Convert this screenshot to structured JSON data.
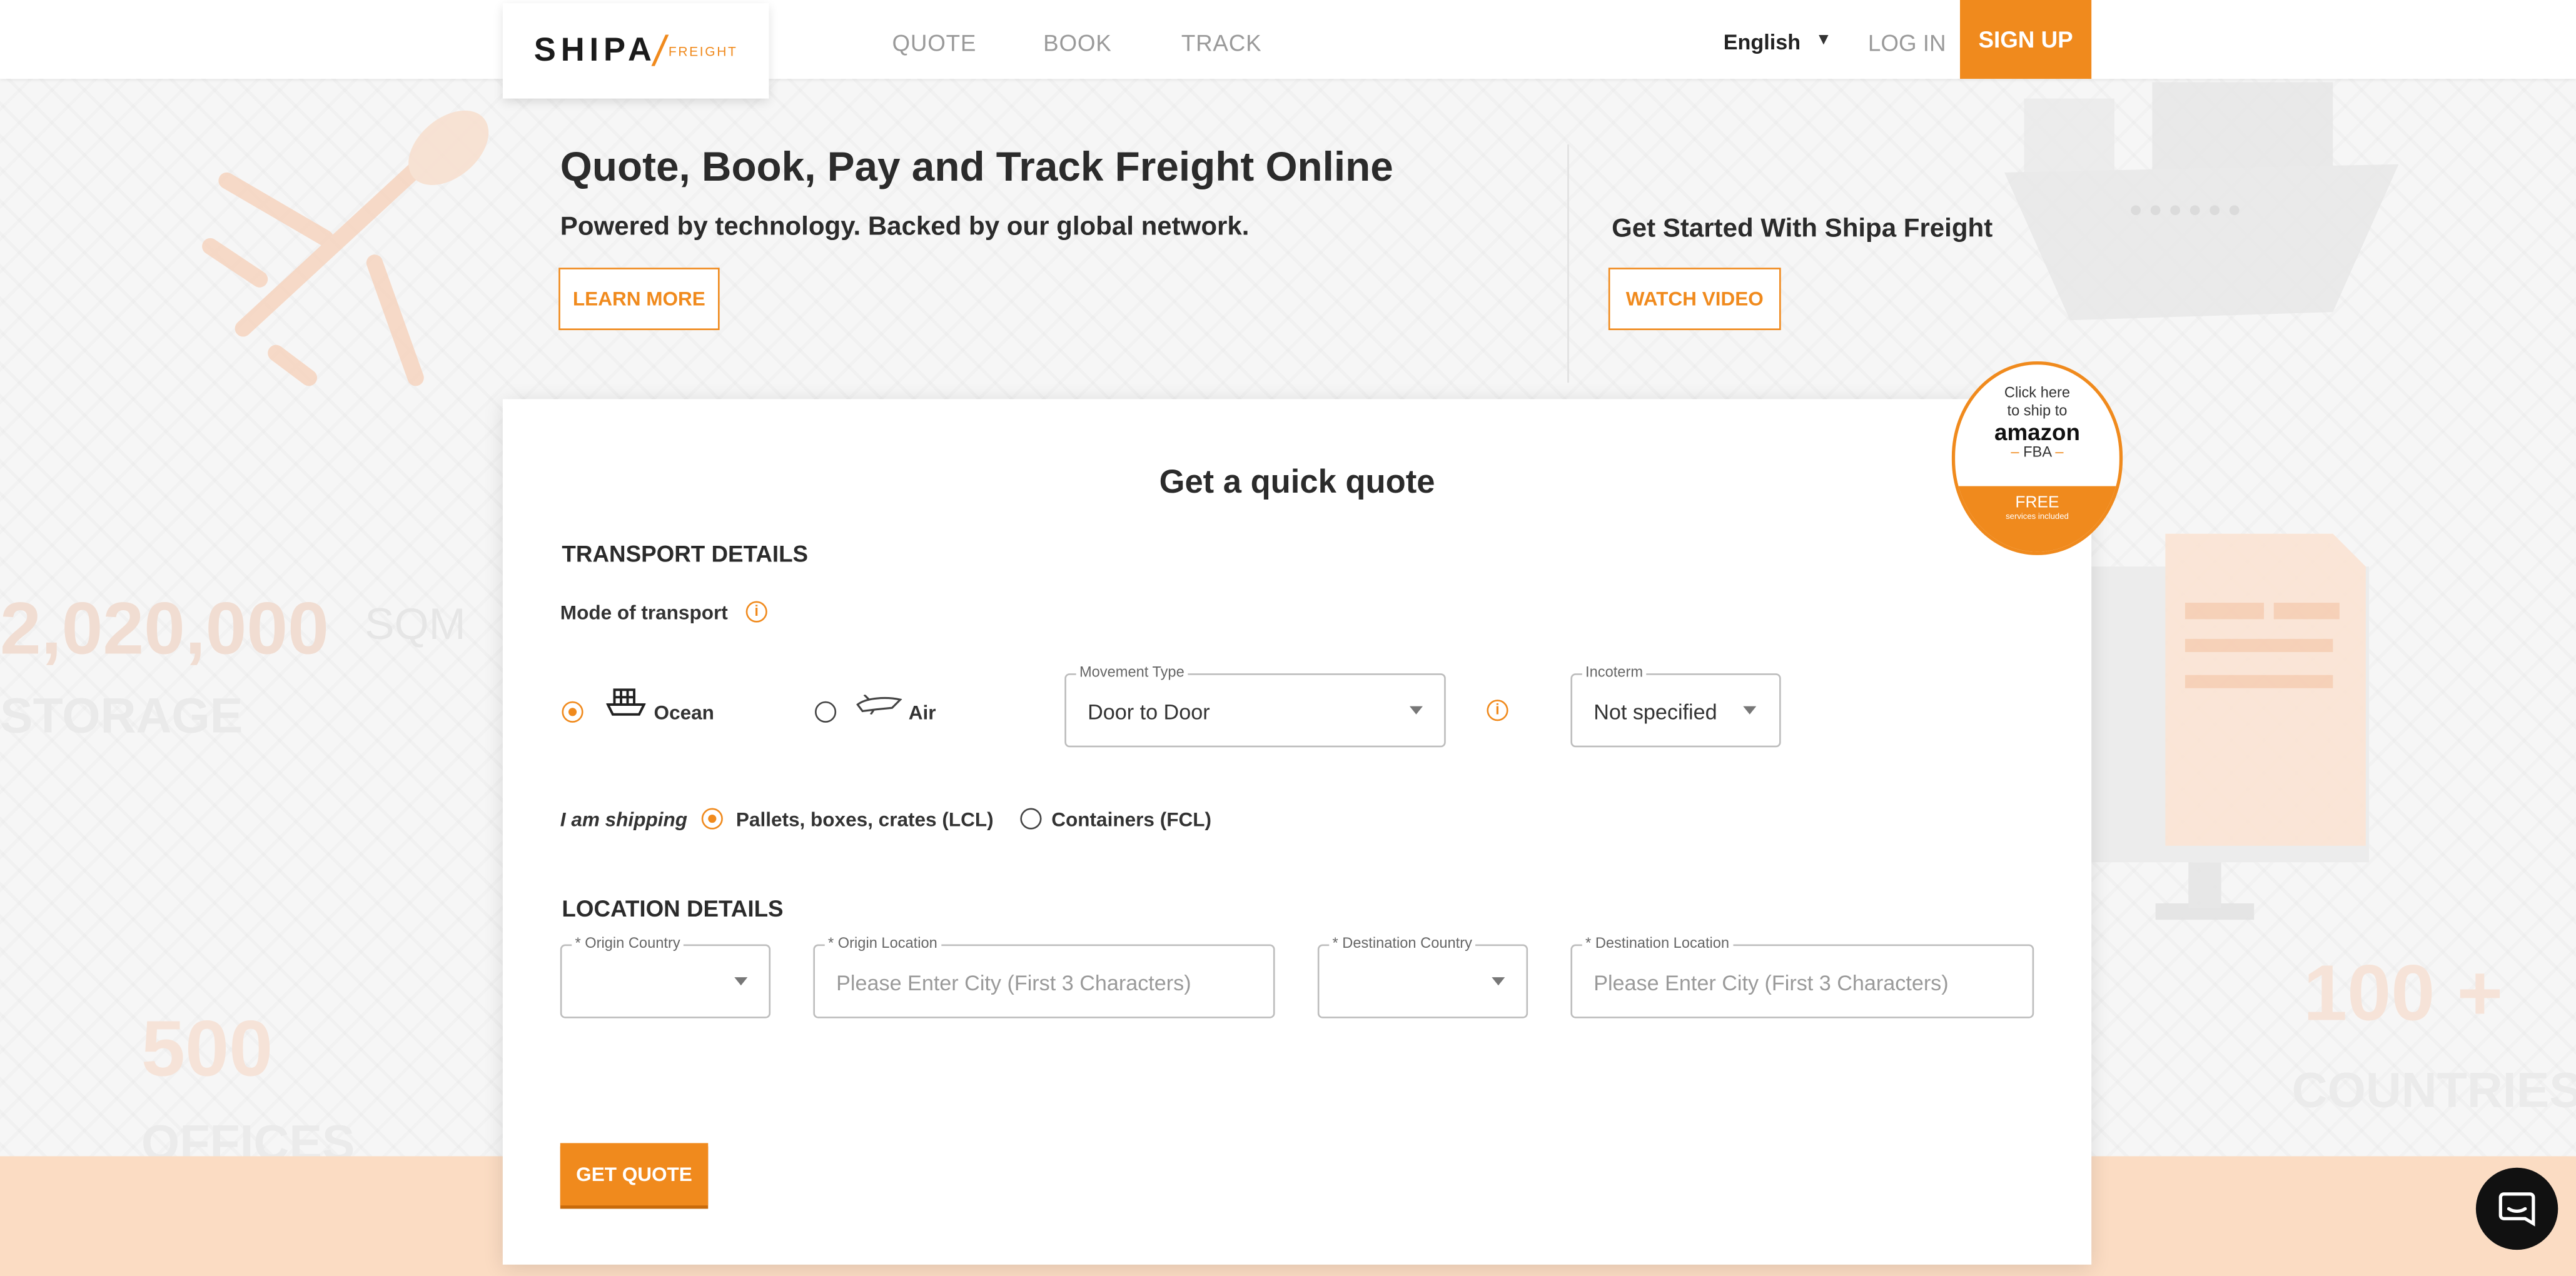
{
  "nav": {
    "logo_main": "SHIPA",
    "logo_sub": "FREIGHT",
    "links": [
      "QUOTE",
      "BOOK",
      "TRACK"
    ],
    "language": "English",
    "login": "LOG IN",
    "signup": "SIGN UP"
  },
  "hero": {
    "title": "Quote, Book, Pay and Track Freight Online",
    "subtitle": "Powered by technology. Backed by our global network.",
    "learn_more": "LEARN MORE",
    "get_started": "Get Started With Shipa Freight",
    "watch_video": "WATCH VIDEO"
  },
  "background_stats": {
    "storage_value": "2,020,000",
    "storage_unit": "SQM",
    "storage_label": "STORAGE",
    "offices_value": "500",
    "offices_label": "OFFICES",
    "countries_value": "100 +",
    "countries_label": "COUNTRIES"
  },
  "quote": {
    "title": "Get a quick quote",
    "transport_heading": "TRANSPORT DETAILS",
    "mode_label": "Mode of transport",
    "mode_options": [
      "Ocean",
      "Air"
    ],
    "mode_selected": "Ocean",
    "movement_type_label": "Movement Type",
    "movement_type_value": "Door to Door",
    "incoterm_label": "Incoterm",
    "incoterm_value": "Not specified",
    "shipping_label": "I am shipping",
    "shipping_options": [
      "Pallets, boxes, crates (LCL)",
      "Containers (FCL)"
    ],
    "shipping_selected": "Pallets, boxes, crates (LCL)",
    "location_heading": "LOCATION DETAILS",
    "origin_country_label": "* Origin Country",
    "origin_location_label": "* Origin Location",
    "origin_location_placeholder": "Please Enter City (First 3 Characters)",
    "destination_country_label": "* Destination Country",
    "destination_location_label": "* Destination Location",
    "destination_location_placeholder": "Please Enter City (First 3 Characters)",
    "get_quote": "GET QUOTE"
  },
  "amazon_badge": {
    "line1": "Click here",
    "line2": "to ship to",
    "brand": "amazon",
    "fba": "FBA",
    "free": "FREE",
    "services": "services included"
  },
  "icons": {
    "info": "info-icon",
    "ship": "ship-icon",
    "plane": "plane-icon",
    "chat": "chat-icon",
    "caret": "chevron-down-icon"
  },
  "colors": {
    "accent": "#f08a1d",
    "text": "#2b2b2b",
    "band": "#fbdcc3"
  }
}
